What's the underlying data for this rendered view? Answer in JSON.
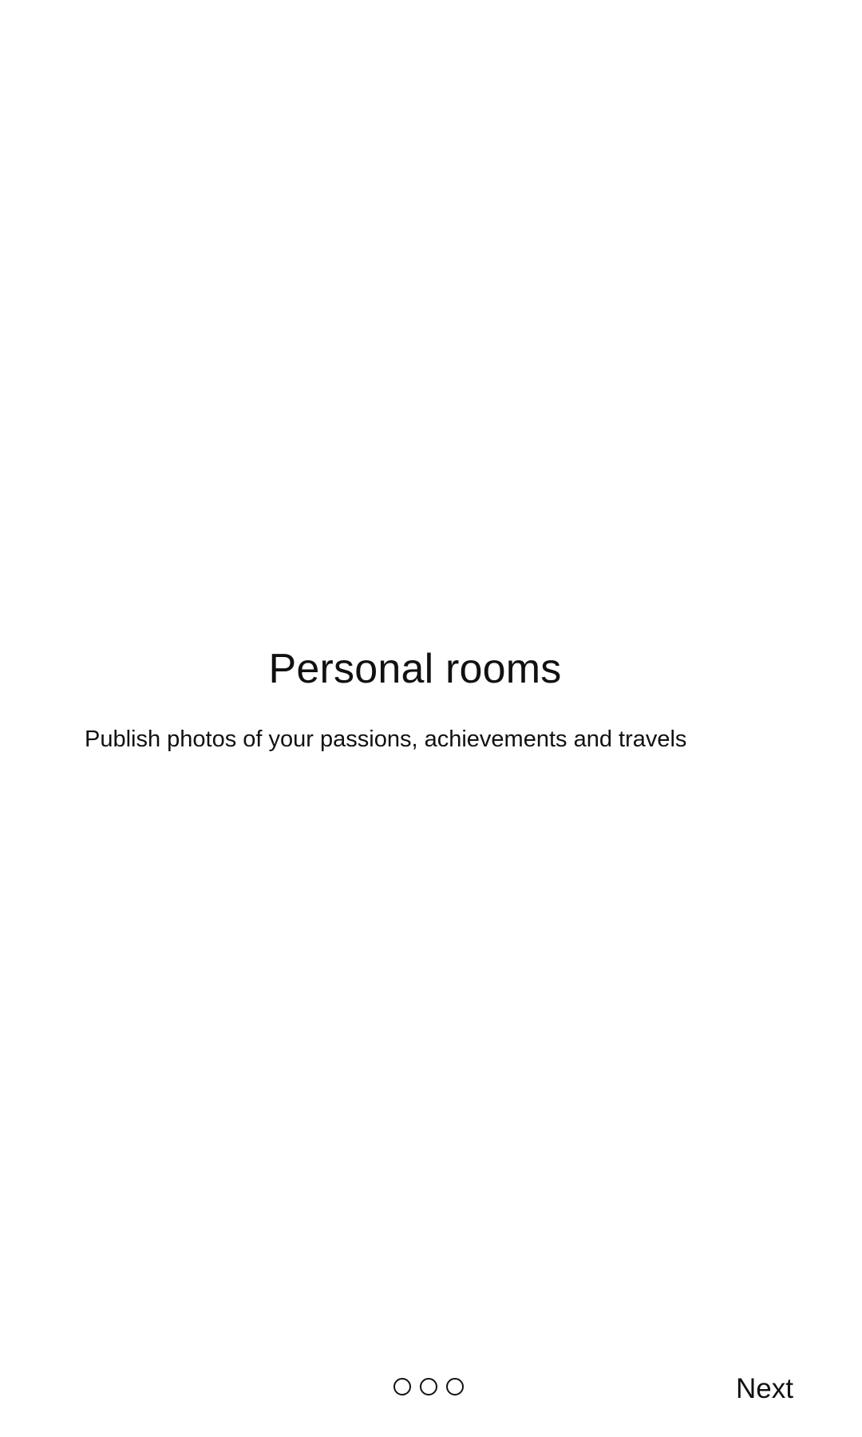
{
  "onboarding": {
    "title": "Personal rooms",
    "subtitle": "Publish photos of your passions, achievements and travels"
  },
  "pager": {
    "page_count": 3,
    "dots": [
      {
        "icon": "page-indicator-dot-outline"
      },
      {
        "icon": "page-indicator-dot-outline"
      },
      {
        "icon": "page-indicator-dot-outline"
      }
    ]
  },
  "navigation": {
    "next_label": "Next"
  },
  "colors": {
    "background": "#ffffff",
    "text": "#111111"
  }
}
